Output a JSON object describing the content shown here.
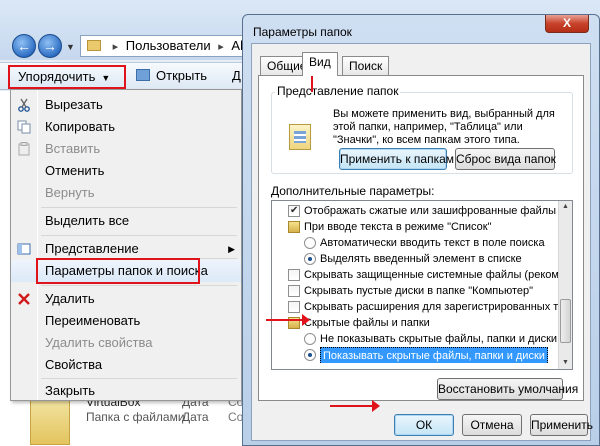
{
  "explorer": {
    "address": {
      "crumbs": [
        "Пользователи",
        "Alex"
      ]
    },
    "toolbar": {
      "organize": "Упорядочить",
      "open": "Открыть",
      "clipped": "Д"
    },
    "file": {
      "name": "VirtualBox",
      "type": "Папка с файлами",
      "date_label": "Дата",
      "date_label2": "Дата",
      "col3": "Состо",
      "col3b": "Состо"
    }
  },
  "organize_menu": {
    "items": [
      {
        "label": "Вырезать",
        "enabled": true,
        "icon": "scissors-icon"
      },
      {
        "label": "Копировать",
        "enabled": true,
        "icon": "copy-icon"
      },
      {
        "label": "Вставить",
        "enabled": false,
        "icon": "paste-icon"
      },
      {
        "label": "Отменить",
        "enabled": true
      },
      {
        "label": "Вернуть",
        "enabled": false
      },
      {
        "label": "Выделить все",
        "enabled": true
      },
      {
        "label": "Представление",
        "enabled": true,
        "icon": "layout-icon",
        "submenu": true
      },
      {
        "label": "Параметры папок и поиска",
        "enabled": true,
        "highlighted": true
      },
      {
        "label": "Удалить",
        "enabled": true,
        "icon": "delete-icon"
      },
      {
        "label": "Переименовать",
        "enabled": true
      },
      {
        "label": "Удалить свойства",
        "enabled": false
      },
      {
        "label": "Свойства",
        "enabled": true
      },
      {
        "label": "Закрыть",
        "enabled": true
      }
    ]
  },
  "dialog": {
    "title": "Параметры папок",
    "close": "X",
    "tabs": [
      "Общие",
      "Вид",
      "Поиск"
    ],
    "active_tab": "Вид",
    "folder_view": {
      "group_label": "Представление папок",
      "description": "Вы можете применить вид, выбранный для этой папки, например, \"Таблица\" или \"Значки\", ко всем папкам этого типа.",
      "apply_button": "Применить к папкам",
      "reset_button": "Сброс вида папок"
    },
    "advanced": {
      "label": "Дополнительные параметры:",
      "items": [
        {
          "kind": "checkbox",
          "checked": true,
          "indent": 1,
          "text": "Отображать сжатые или зашифрованные файлы NTI"
        },
        {
          "kind": "folder",
          "indent": 1,
          "text": "При вводе текста в режиме \"Список\""
        },
        {
          "kind": "radio",
          "checked": false,
          "indent": 2,
          "text": "Автоматически вводить текст в поле поиска"
        },
        {
          "kind": "radio",
          "checked": true,
          "indent": 2,
          "text": "Выделять введенный элемент в списке"
        },
        {
          "kind": "checkbox",
          "checked": false,
          "indent": 1,
          "text": "Скрывать защищенные системные файлы (рекомен"
        },
        {
          "kind": "checkbox",
          "checked": false,
          "indent": 1,
          "text": "Скрывать пустые диски в папке \"Компьютер\""
        },
        {
          "kind": "checkbox",
          "checked": false,
          "indent": 1,
          "text": "Скрывать расширения для зарегистрированных типо"
        },
        {
          "kind": "folder",
          "indent": 1,
          "text": "Скрытые файлы и папки"
        },
        {
          "kind": "radio",
          "checked": false,
          "indent": 2,
          "text": "Не показывать скрытые файлы, папки и диски"
        },
        {
          "kind": "radio",
          "checked": true,
          "indent": 2,
          "selected": true,
          "text": "Показывать скрытые файлы, папки и диски"
        }
      ]
    },
    "restore_button": "Восстановить умолчания",
    "ok_button": "ОК",
    "cancel_button": "Отмена",
    "apply_button_label": "Применить"
  },
  "colors": {
    "annotation_red": "#e0131b",
    "selection_blue": "#3399ff"
  }
}
